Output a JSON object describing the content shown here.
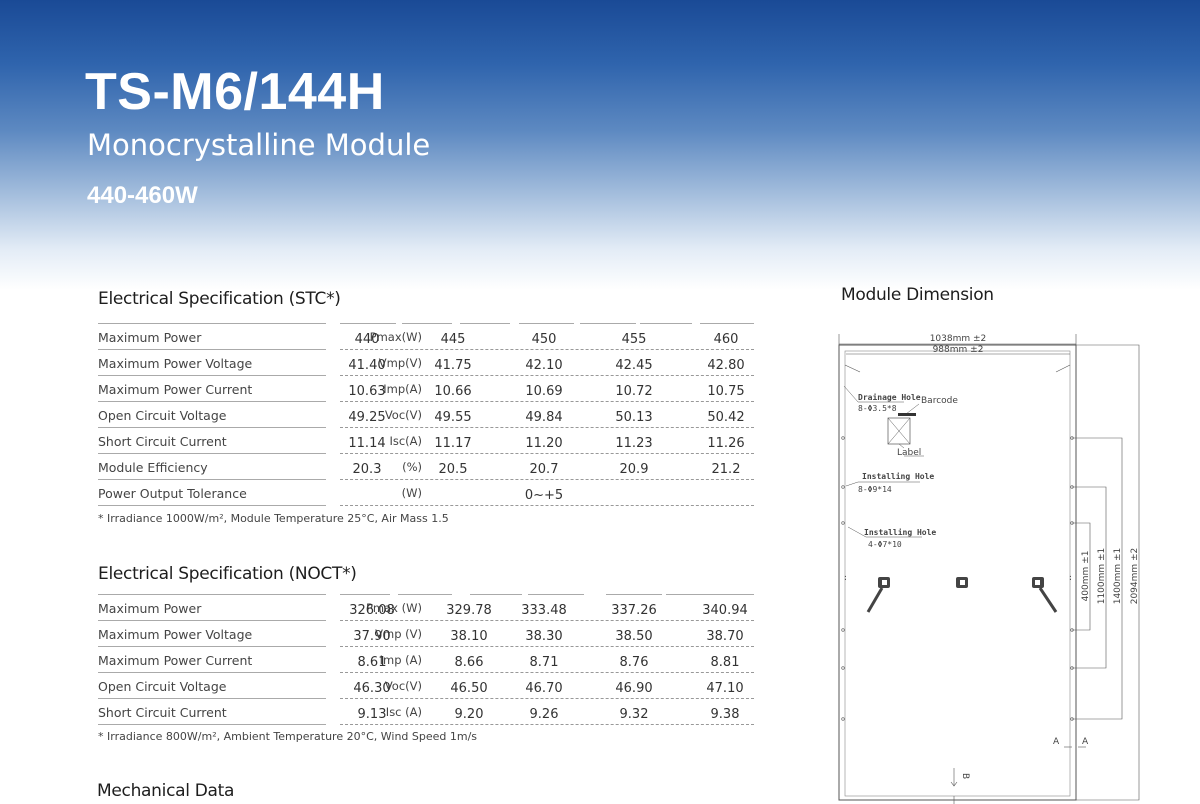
{
  "header": {
    "model": "TS-M6/144H",
    "subtitle": "Monocrystalline Module",
    "power_range": "440-460W"
  },
  "colors": {
    "hero_top": "#1a4a96",
    "hero_bottom": "#ffffff"
  },
  "stc": {
    "title": "Electrical Specification (STC*)",
    "rows": [
      {
        "label": "Maximum Power",
        "unit": "Pmax(W)",
        "values": [
          "440",
          "445",
          "450",
          "455",
          "460"
        ]
      },
      {
        "label": "Maximum Power Voltage",
        "unit": "Vmp(V)",
        "values": [
          "41.40",
          "41.75",
          "42.10",
          "42.45",
          "42.80"
        ]
      },
      {
        "label": "Maximum Power Current",
        "unit": "Imp(A)",
        "values": [
          "10.63",
          "10.66",
          "10.69",
          "10.72",
          "10.75"
        ]
      },
      {
        "label": "Open Circuit Voltage",
        "unit": "Voc(V)",
        "values": [
          "49.25",
          "49.55",
          "49.84",
          "50.13",
          "50.42"
        ]
      },
      {
        "label": "Short Circuit Current",
        "unit": "Isc(A)",
        "values": [
          "11.14",
          "11.17",
          "11.20",
          "11.23",
          "11.26"
        ]
      },
      {
        "label": "Module Efficiency",
        "unit": "(%)",
        "values": [
          "20.3",
          "20.5",
          "20.7",
          "20.9",
          "21.2"
        ]
      },
      {
        "label": "Power Output Tolerance",
        "unit": "(W)",
        "values": [
          "",
          "",
          "0~+5",
          "",
          ""
        ]
      }
    ],
    "note": "* Irradiance 1000W/m², Module Temperature 25°C, Air Mass 1.5"
  },
  "noct": {
    "title": "Electrical Specification (NOCT*)",
    "rows": [
      {
        "label": "Maximum Power",
        "unit": "Pmax (W)",
        "values": [
          "326.08",
          "329.78",
          "333.48",
          "337.26",
          "340.94"
        ]
      },
      {
        "label": "Maximum Power Voltage",
        "unit": "Vmp (V)",
        "values": [
          "37.90",
          "38.10",
          "38.30",
          "38.50",
          "38.70"
        ]
      },
      {
        "label": "Maximum Power Current",
        "unit": "Imp (A)",
        "values": [
          "8.61",
          "8.66",
          "8.71",
          "8.76",
          "8.81"
        ]
      },
      {
        "label": "Open Circuit Voltage",
        "unit": "Voc(V)",
        "values": [
          "46.30",
          "46.50",
          "46.70",
          "46.90",
          "47.10"
        ]
      },
      {
        "label": "Short Circuit Current",
        "unit": "Isc (A)",
        "values": [
          "9.13",
          "9.20",
          "9.26",
          "9.32",
          "9.38"
        ]
      }
    ],
    "note": "* Irradiance 800W/m², Ambient Temperature 20°C, Wind Speed 1m/s"
  },
  "mechanical": {
    "title": "Mechanical Data"
  },
  "dimension": {
    "title": "Module Dimension",
    "width_outer": "1038mm ±2",
    "width_inner": "988mm ±2",
    "drainage_hole": "Drainage Hole",
    "drainage_spec": "8-Φ3.5*8",
    "barcode": "Barcode",
    "label": "Label",
    "installing_hole_1": "Installing Hole",
    "installing_spec_1": "8-Φ9*14",
    "installing_hole_2": "Installing Hole",
    "installing_spec_2": "4-Φ7*10",
    "dim_400": "400mm ±1",
    "dim_1100": "1100mm ±1",
    "dim_1400": "1400mm ±1",
    "dim_2094": "2094mm ±2",
    "section_a": "A",
    "section_b": "B"
  }
}
